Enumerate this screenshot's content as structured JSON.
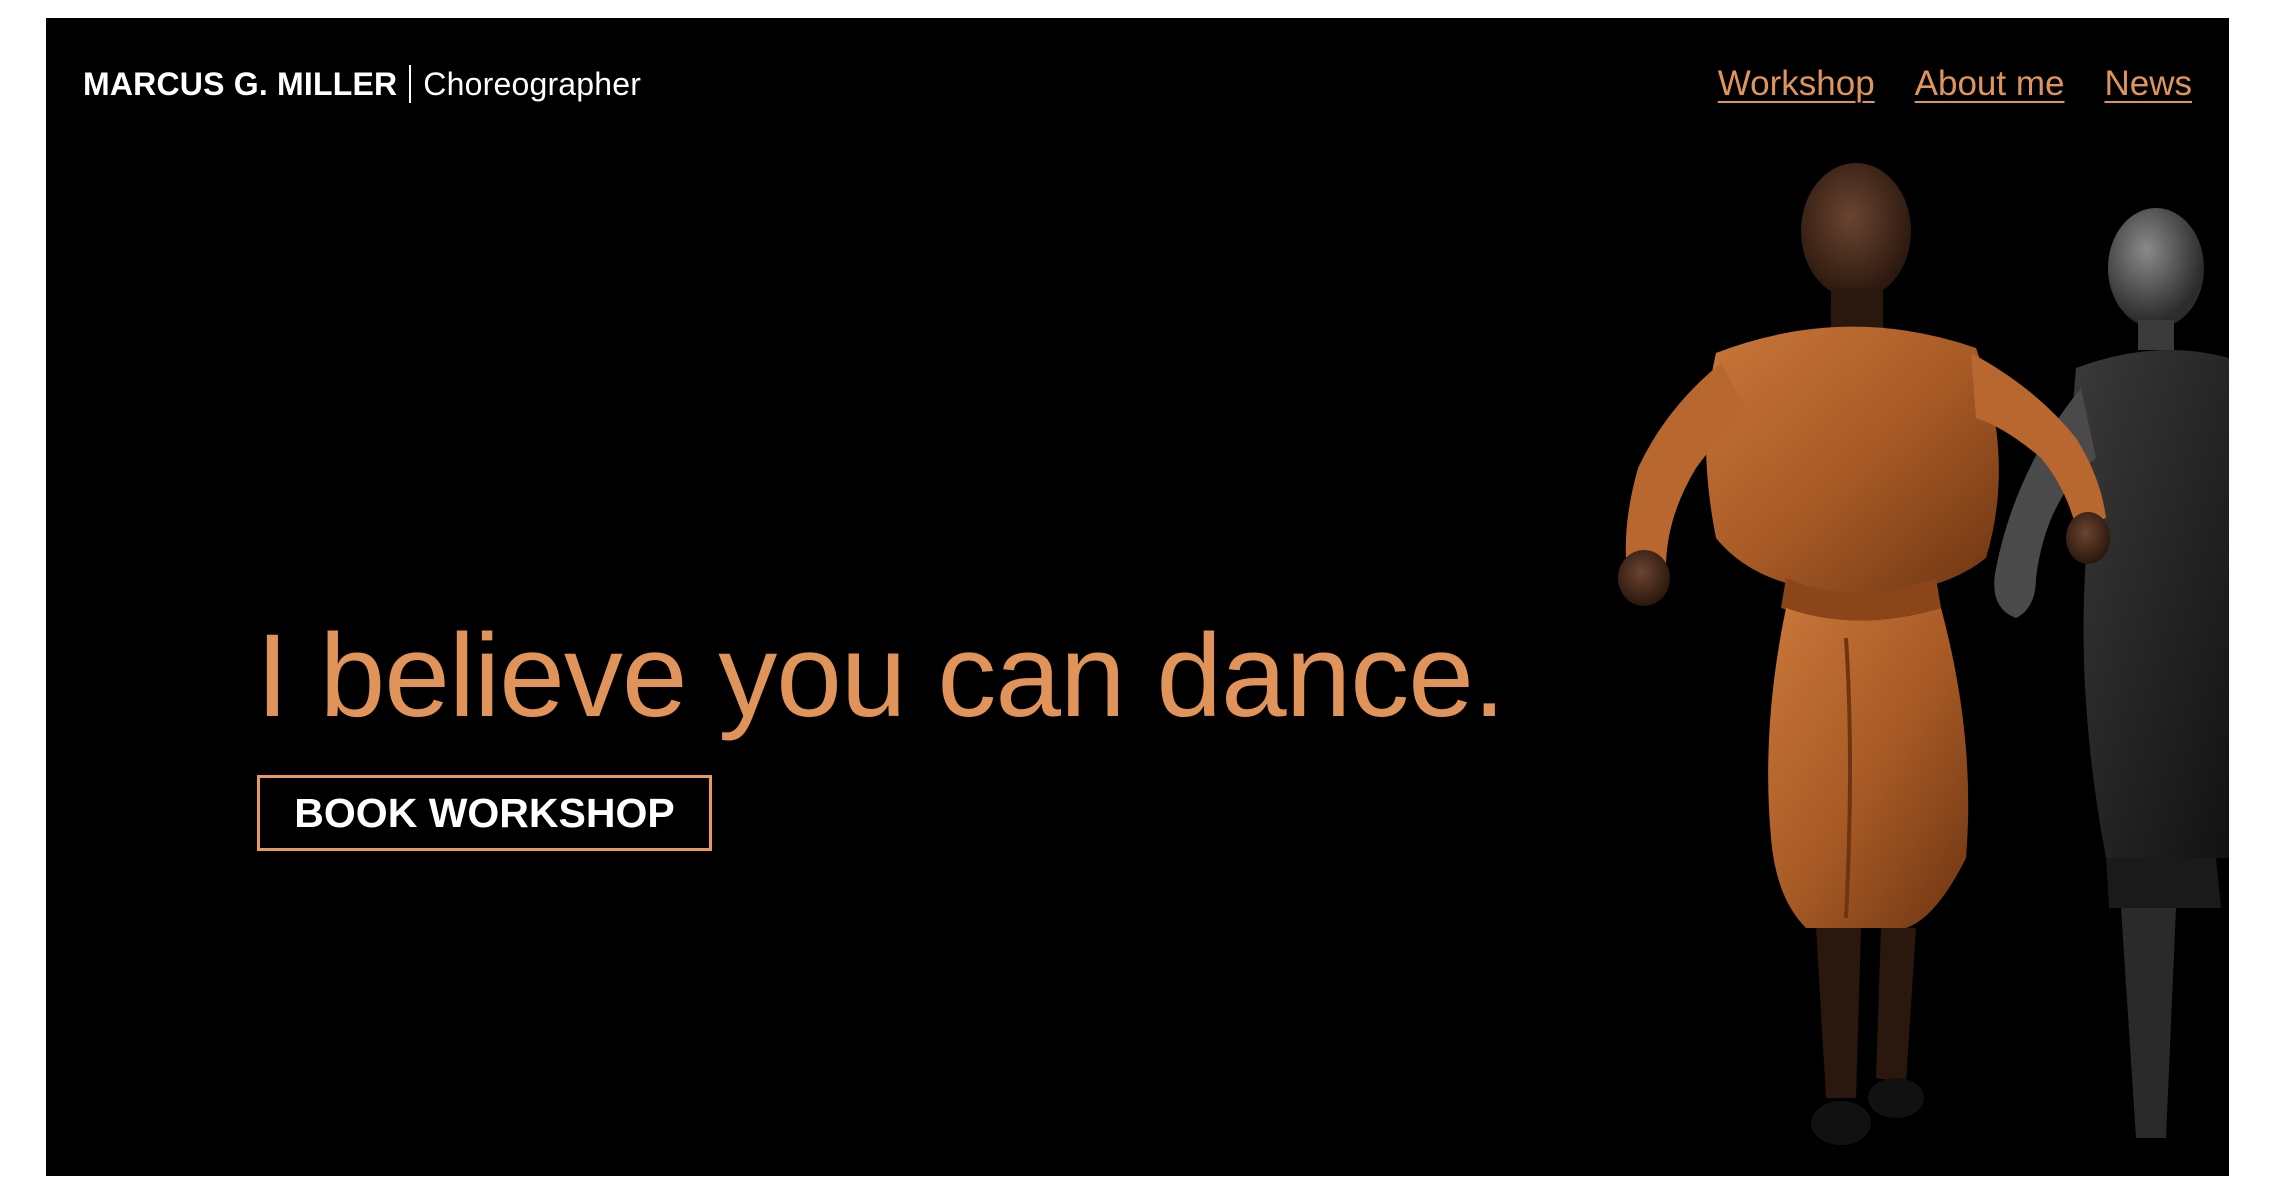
{
  "header": {
    "brand_name": "MARCUS G. MILLER",
    "brand_role": "Choreographer",
    "nav": [
      {
        "label": "Workshop"
      },
      {
        "label": "About me"
      },
      {
        "label": "News"
      }
    ]
  },
  "hero": {
    "headline": "I believe you can dance.",
    "cta_label": "BOOK WORKSHOP",
    "image": "dancers-photo"
  },
  "colors": {
    "background": "#000000",
    "accent": "#e0945a",
    "text": "#ffffff",
    "page": "#ffffff"
  }
}
